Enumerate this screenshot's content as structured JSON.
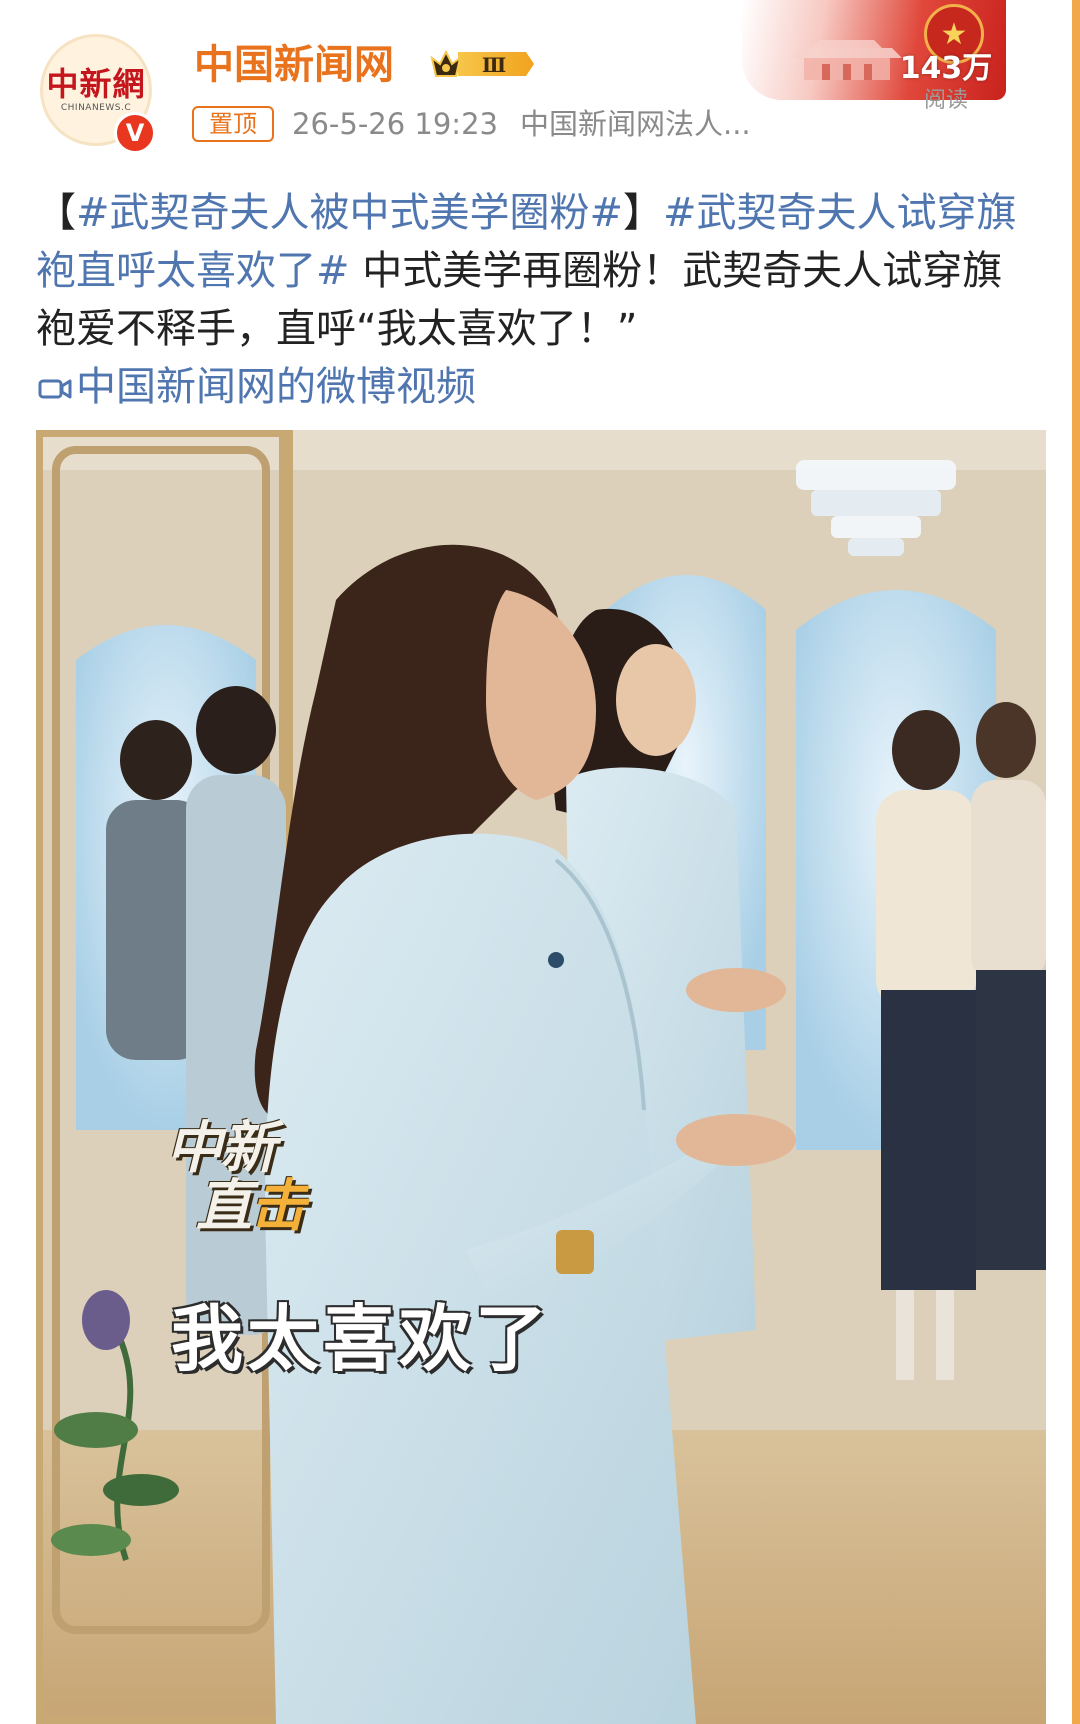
{
  "author": {
    "name": "中国新闻网",
    "avatar_text": "中新網",
    "avatar_sub": "CHINANEWS.C",
    "verified_mark": "V",
    "vip_level": "Ⅲ"
  },
  "post_meta": {
    "pin_label": "置顶",
    "timestamp": "26-5-26 19:23",
    "source": "中国新闻网法人..."
  },
  "stats": {
    "view_count": "143万",
    "view_label": "阅读"
  },
  "post": {
    "hashtag_1": "#武契奇夫人被中式美学圈粉#",
    "bracket_open": "【",
    "bracket_close": "】",
    "hashtag_2": "#武契奇夫人试穿旗袍直呼太喜欢了#",
    "body": " 中式美学再圈粉！武契奇夫人试穿旗袍爱不释手，直呼“我太喜欢了！”",
    "video_link": "中国新闻网的微博视频"
  },
  "video": {
    "watermark_line1": "中新",
    "watermark_line2_a": "直",
    "watermark_line2_b": "击",
    "subtitle": "我太喜欢了"
  },
  "colors": {
    "accent_orange": "#e8731c",
    "link_blue": "#5076b0",
    "verified_red": "#e8361f",
    "card_border": "#f0a84a"
  }
}
